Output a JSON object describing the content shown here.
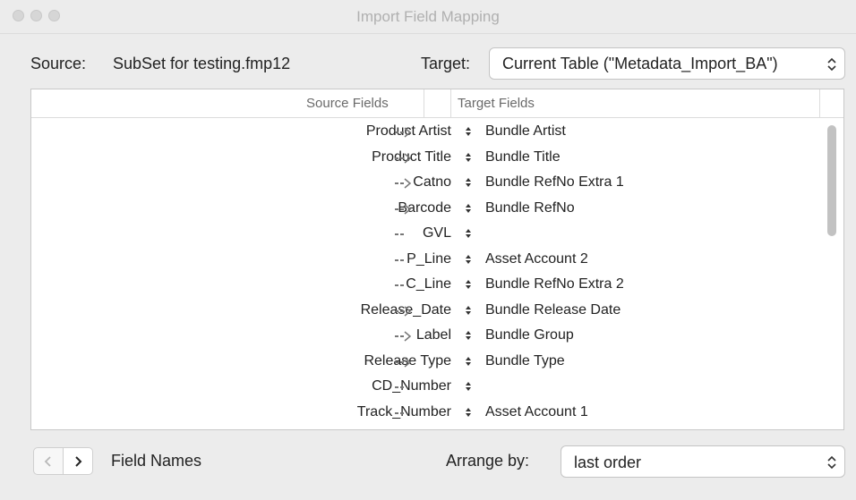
{
  "window": {
    "title": "Import Field Mapping"
  },
  "source": {
    "label": "Source:",
    "value": "SubSet for testing.fmp12"
  },
  "target": {
    "label": "Target:",
    "value": "Current Table (\"Metadata_Import_BA\")"
  },
  "table": {
    "headers": {
      "source": "Source Fields",
      "target": "Target Fields"
    },
    "rows": [
      {
        "source": "Product Artist",
        "action": "import",
        "target": "Bundle Artist"
      },
      {
        "source": "Product Title",
        "action": "import",
        "target": "Bundle Title"
      },
      {
        "source": "Catno",
        "action": "import",
        "target": "Bundle RefNo Extra 1"
      },
      {
        "source": "Barcode",
        "action": "import",
        "target": "Bundle RefNo"
      },
      {
        "source": "GVL",
        "action": "skip",
        "target": ""
      },
      {
        "source": "P_Line",
        "action": "skip",
        "target": "Asset Account 2"
      },
      {
        "source": "C_Line",
        "action": "skip",
        "target": "Bundle RefNo Extra 2"
      },
      {
        "source": "Release_Date",
        "action": "import",
        "target": "Bundle Release Date"
      },
      {
        "source": "Label",
        "action": "import",
        "target": "Bundle Group"
      },
      {
        "source": "Release Type",
        "action": "import",
        "target": "Bundle Type"
      },
      {
        "source": "CD_Number",
        "action": "skip",
        "target": ""
      },
      {
        "source": "Track_Number",
        "action": "skip",
        "target": "Asset Account 1"
      }
    ]
  },
  "footer": {
    "field_names_label": "Field Names",
    "arrange_label": "Arrange by:",
    "arrange_value": "last order"
  }
}
